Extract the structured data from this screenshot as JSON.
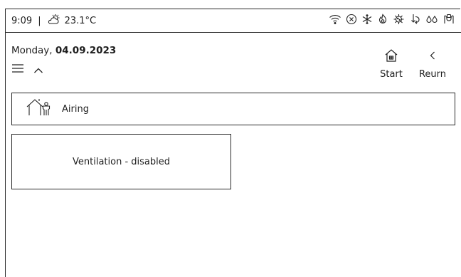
{
  "status": {
    "time": "9:09",
    "separator": "|",
    "temperature": "23.1°C",
    "icons": [
      "partly-sunny-icon",
      "wifi-icon",
      "close-circle-icon",
      "snowflake-icon",
      "flame-icon",
      "virus-icon",
      "cooling-arrows-icon",
      "water-drops-icon",
      "plug-icon"
    ]
  },
  "header": {
    "date_prefix": "Monday, ",
    "date_value": "04.09.2023"
  },
  "nav": {
    "start_label": "Start",
    "return_label": "Reurn"
  },
  "airing": {
    "label": "Airing"
  },
  "ventilation": {
    "label": "Ventilation - disabled"
  }
}
